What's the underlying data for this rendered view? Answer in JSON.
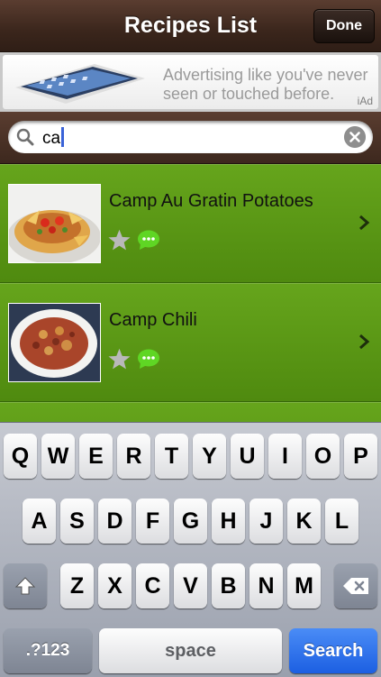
{
  "navbar": {
    "title": "Recipes List",
    "done_label": "Done"
  },
  "ad": {
    "line1": "Advertising like you've never",
    "line2": "seen or touched before.",
    "mark": "iAd"
  },
  "search": {
    "value": "ca"
  },
  "recipes": [
    {
      "title": "Camp Au Gratin Potatoes",
      "favorite": false
    },
    {
      "title": "Camp Chili",
      "favorite": false
    }
  ],
  "keyboard": {
    "row1": [
      "Q",
      "W",
      "E",
      "R",
      "T",
      "Y",
      "U",
      "I",
      "O",
      "P"
    ],
    "row2": [
      "A",
      "S",
      "D",
      "F",
      "G",
      "H",
      "J",
      "K",
      "L"
    ],
    "row3": [
      "Z",
      "X",
      "C",
      "V",
      "B",
      "N",
      "M"
    ],
    "numbers_label": ".?123",
    "space_label": "space",
    "search_label": "Search"
  },
  "colors": {
    "navbar": "#3b261c",
    "list_green": "#5e9c15",
    "search_key": "#1c5fe2"
  }
}
